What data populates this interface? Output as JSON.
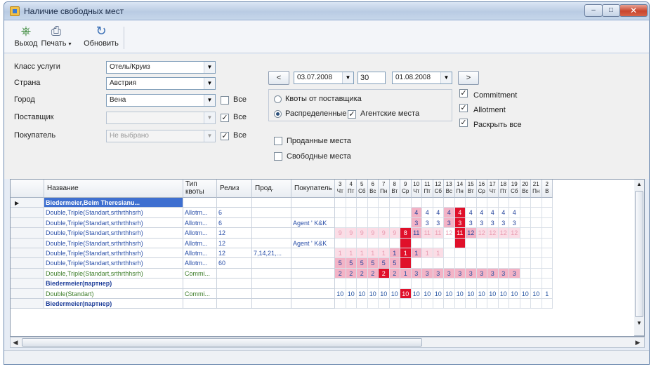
{
  "window": {
    "title": "Наличие свободных мест"
  },
  "toolbar": {
    "exit": "Выход",
    "print": "Печать",
    "refresh": "Обновить"
  },
  "filters": {
    "service_class": {
      "label": "Класс услуги",
      "value": "Отель/Круиз"
    },
    "country": {
      "label": "Страна",
      "value": "Австрия"
    },
    "city": {
      "label": "Город",
      "value": "Вена",
      "all_label": "Все"
    },
    "supplier": {
      "label": "Поставщик",
      "value": "",
      "all_label": "Все"
    },
    "buyer": {
      "label": "Покупатель",
      "value": "Не выбрано",
      "all_label": "Все"
    }
  },
  "period": {
    "prev": "<",
    "start": "03.07.2008",
    "days": "30",
    "end": "01.08.2008",
    "next": ">"
  },
  "quota": {
    "supplier_quota": "Квоты от поставщика",
    "distributed": "Распределенные",
    "agency_seats": "Агентские места"
  },
  "options": {
    "commitment": "Commitment",
    "allotment": "Allotment",
    "expand_all": "Раскрыть все"
  },
  "show": {
    "sold": "Проданные места",
    "free": "Свободные места"
  },
  "grid": {
    "headers": {
      "name": "Название",
      "type": "Тип квоты",
      "release": "Релиз",
      "prod": "Прод.",
      "buyer": "Покупатель"
    },
    "days": [
      {
        "d": "3",
        "w": "Чт"
      },
      {
        "d": "4",
        "w": "Пт"
      },
      {
        "d": "5",
        "w": "Сб"
      },
      {
        "d": "6",
        "w": "Вс"
      },
      {
        "d": "7",
        "w": "Пн"
      },
      {
        "d": "8",
        "w": "Вт"
      },
      {
        "d": "9",
        "w": "Ср"
      },
      {
        "d": "10",
        "w": "Чт"
      },
      {
        "d": "11",
        "w": "Пт"
      },
      {
        "d": "12",
        "w": "Сб"
      },
      {
        "d": "13",
        "w": "Вс"
      },
      {
        "d": "14",
        "w": "Пн"
      },
      {
        "d": "15",
        "w": "Вт"
      },
      {
        "d": "16",
        "w": "Ср"
      },
      {
        "d": "17",
        "w": "Чт"
      },
      {
        "d": "18",
        "w": "Пт"
      },
      {
        "d": "19",
        "w": "Сб"
      },
      {
        "d": "20",
        "w": "Вс"
      },
      {
        "d": "21",
        "w": "Пн"
      },
      {
        "d": "2",
        "w": "В"
      }
    ],
    "rows": [
      {
        "kind": "group",
        "name": "Biedermeier,Beim Theresianu...",
        "type": "",
        "release": "",
        "prod": "",
        "buyer": "",
        "selected": true,
        "cells": []
      },
      {
        "kind": "blue",
        "name": "Double,Triple(Standart,srthrthhsrh)",
        "type": "Allotm...",
        "release": "6",
        "prod": "",
        "buyer": "",
        "cells": [
          {
            "v": "",
            "s": ""
          },
          {
            "v": "",
            "s": ""
          },
          {
            "v": "",
            "s": ""
          },
          {
            "v": "",
            "s": ""
          },
          {
            "v": "",
            "s": ""
          },
          {
            "v": "",
            "s": ""
          },
          {
            "v": "",
            "s": ""
          },
          {
            "v": "4",
            "s": "p"
          },
          {
            "v": "4",
            "s": ""
          },
          {
            "v": "4",
            "s": ""
          },
          {
            "v": "4",
            "s": "p"
          },
          {
            "v": "4",
            "s": "r"
          },
          {
            "v": "4",
            "s": ""
          },
          {
            "v": "4",
            "s": ""
          },
          {
            "v": "4",
            "s": ""
          },
          {
            "v": "4",
            "s": ""
          },
          {
            "v": "4",
            "s": ""
          },
          {
            "v": "",
            "s": ""
          },
          {
            "v": "",
            "s": ""
          },
          {
            "v": "",
            "s": ""
          }
        ]
      },
      {
        "kind": "blue",
        "name": "Double,Triple(Standart,srthrthhsrh)",
        "type": "Allotm...",
        "release": "6",
        "prod": "",
        "buyer": "Agent ' K&K",
        "cells": [
          {
            "v": "",
            "s": ""
          },
          {
            "v": "",
            "s": ""
          },
          {
            "v": "",
            "s": ""
          },
          {
            "v": "",
            "s": ""
          },
          {
            "v": "",
            "s": ""
          },
          {
            "v": "",
            "s": ""
          },
          {
            "v": "",
            "s": ""
          },
          {
            "v": "3",
            "s": "p"
          },
          {
            "v": "3",
            "s": ""
          },
          {
            "v": "3",
            "s": ""
          },
          {
            "v": "3",
            "s": "p"
          },
          {
            "v": "3",
            "s": "r"
          },
          {
            "v": "3",
            "s": ""
          },
          {
            "v": "3",
            "s": ""
          },
          {
            "v": "3",
            "s": ""
          },
          {
            "v": "3",
            "s": ""
          },
          {
            "v": "3",
            "s": ""
          },
          {
            "v": "",
            "s": ""
          },
          {
            "v": "",
            "s": ""
          },
          {
            "v": "",
            "s": ""
          }
        ]
      },
      {
        "kind": "blue",
        "name": "Double,Triple(Standart,srthrthhsrh)",
        "type": "Allotm...",
        "release": "12",
        "prod": "",
        "buyer": "",
        "cells": [
          {
            "v": "9",
            "s": "l"
          },
          {
            "v": "9",
            "s": "l"
          },
          {
            "v": "9",
            "s": "l"
          },
          {
            "v": "9",
            "s": "l"
          },
          {
            "v": "9",
            "s": "l"
          },
          {
            "v": "9",
            "s": "l"
          },
          {
            "v": "8",
            "s": "r"
          },
          {
            "v": "11",
            "s": "p"
          },
          {
            "v": "11",
            "s": "l"
          },
          {
            "v": "11",
            "s": "l"
          },
          {
            "v": "12",
            "s": "f"
          },
          {
            "v": "11",
            "s": "r"
          },
          {
            "v": "12",
            "s": "p"
          },
          {
            "v": "12",
            "s": "l"
          },
          {
            "v": "12",
            "s": "l"
          },
          {
            "v": "12",
            "s": "l"
          },
          {
            "v": "12",
            "s": "l"
          },
          {
            "v": "",
            "s": ""
          },
          {
            "v": "",
            "s": ""
          },
          {
            "v": "",
            "s": ""
          }
        ]
      },
      {
        "kind": "blue",
        "name": "Double,Triple(Standart,srthrthhsrh)",
        "type": "Allotm...",
        "release": "12",
        "prod": "",
        "buyer": "Agent ' K&K",
        "cells": [
          {
            "v": "",
            "s": ""
          },
          {
            "v": "",
            "s": ""
          },
          {
            "v": "",
            "s": ""
          },
          {
            "v": "",
            "s": ""
          },
          {
            "v": "",
            "s": ""
          },
          {
            "v": "",
            "s": ""
          },
          {
            "v": "",
            "s": "r"
          },
          {
            "v": "",
            "s": ""
          },
          {
            "v": "",
            "s": ""
          },
          {
            "v": "",
            "s": ""
          },
          {
            "v": "",
            "s": ""
          },
          {
            "v": "",
            "s": "r"
          },
          {
            "v": "",
            "s": ""
          },
          {
            "v": "",
            "s": ""
          },
          {
            "v": "",
            "s": ""
          },
          {
            "v": "",
            "s": ""
          },
          {
            "v": "",
            "s": ""
          },
          {
            "v": "",
            "s": ""
          },
          {
            "v": "",
            "s": ""
          },
          {
            "v": "",
            "s": ""
          }
        ]
      },
      {
        "kind": "blue",
        "name": "Double,Triple(Standart,srthrthhsrh)",
        "type": "Allotm...",
        "release": "12",
        "prod": "7,14,21,...",
        "buyer": "",
        "cells": [
          {
            "v": "1",
            "s": "l"
          },
          {
            "v": "1",
            "s": "l"
          },
          {
            "v": "1",
            "s": "l"
          },
          {
            "v": "1",
            "s": "l"
          },
          {
            "v": "1",
            "s": "l"
          },
          {
            "v": "1",
            "s": "p"
          },
          {
            "v": "1",
            "s": "r"
          },
          {
            "v": "1",
            "s": "p"
          },
          {
            "v": "1",
            "s": "l"
          },
          {
            "v": "1",
            "s": "l"
          },
          {
            "v": "",
            "s": ""
          },
          {
            "v": "",
            "s": ""
          },
          {
            "v": "",
            "s": ""
          },
          {
            "v": "",
            "s": ""
          },
          {
            "v": "",
            "s": ""
          },
          {
            "v": "",
            "s": ""
          },
          {
            "v": "",
            "s": ""
          },
          {
            "v": "",
            "s": ""
          },
          {
            "v": "",
            "s": ""
          },
          {
            "v": "",
            "s": ""
          }
        ]
      },
      {
        "kind": "blue",
        "name": "Double,Triple(Standart,srthrthhsrh)",
        "type": "Allotm...",
        "release": "60",
        "prod": "",
        "buyer": "",
        "cells": [
          {
            "v": "5",
            "s": "p"
          },
          {
            "v": "5",
            "s": "p"
          },
          {
            "v": "5",
            "s": "p"
          },
          {
            "v": "5",
            "s": "p"
          },
          {
            "v": "5",
            "s": "p"
          },
          {
            "v": "5",
            "s": "p"
          },
          {
            "v": "",
            "s": "r"
          },
          {
            "v": "",
            "s": ""
          },
          {
            "v": "",
            "s": ""
          },
          {
            "v": "",
            "s": ""
          },
          {
            "v": "",
            "s": ""
          },
          {
            "v": "",
            "s": ""
          },
          {
            "v": "",
            "s": ""
          },
          {
            "v": "",
            "s": ""
          },
          {
            "v": "",
            "s": ""
          },
          {
            "v": "",
            "s": ""
          },
          {
            "v": "",
            "s": ""
          },
          {
            "v": "",
            "s": ""
          },
          {
            "v": "",
            "s": ""
          },
          {
            "v": "",
            "s": ""
          }
        ]
      },
      {
        "kind": "green",
        "name": "Double,Triple(Standart,srthrthhsrh)",
        "type": "Commi...",
        "release": "",
        "prod": "",
        "buyer": "",
        "cells": [
          {
            "v": "2",
            "s": "p"
          },
          {
            "v": "2",
            "s": "p"
          },
          {
            "v": "2",
            "s": "p"
          },
          {
            "v": "2",
            "s": "p"
          },
          {
            "v": "2",
            "s": "r"
          },
          {
            "v": "2",
            "s": "p"
          },
          {
            "v": "1",
            "s": "p"
          },
          {
            "v": "3",
            "s": "p"
          },
          {
            "v": "3",
            "s": "p"
          },
          {
            "v": "3",
            "s": "p"
          },
          {
            "v": "3",
            "s": "p"
          },
          {
            "v": "3",
            "s": "p"
          },
          {
            "v": "3",
            "s": "p"
          },
          {
            "v": "3",
            "s": "p"
          },
          {
            "v": "3",
            "s": "p"
          },
          {
            "v": "3",
            "s": "p"
          },
          {
            "v": "3",
            "s": "p"
          },
          {
            "v": "",
            "s": ""
          },
          {
            "v": "",
            "s": ""
          },
          {
            "v": "",
            "s": ""
          }
        ]
      },
      {
        "kind": "head",
        "name": "Biedermeier(партнер)",
        "type": "",
        "release": "",
        "prod": "",
        "buyer": "",
        "cells": []
      },
      {
        "kind": "green",
        "name": "Double(Standart)",
        "type": "Commi...",
        "release": "",
        "prod": "",
        "buyer": "",
        "cells": [
          {
            "v": "10",
            "s": ""
          },
          {
            "v": "10",
            "s": ""
          },
          {
            "v": "10",
            "s": ""
          },
          {
            "v": "10",
            "s": ""
          },
          {
            "v": "10",
            "s": ""
          },
          {
            "v": "10",
            "s": ""
          },
          {
            "v": "10",
            "s": "r"
          },
          {
            "v": "10",
            "s": ""
          },
          {
            "v": "10",
            "s": ""
          },
          {
            "v": "10",
            "s": ""
          },
          {
            "v": "10",
            "s": ""
          },
          {
            "v": "10",
            "s": ""
          },
          {
            "v": "10",
            "s": ""
          },
          {
            "v": "10",
            "s": ""
          },
          {
            "v": "10",
            "s": ""
          },
          {
            "v": "10",
            "s": ""
          },
          {
            "v": "10",
            "s": ""
          },
          {
            "v": "10",
            "s": ""
          },
          {
            "v": "10",
            "s": ""
          },
          {
            "v": "1",
            "s": ""
          }
        ]
      },
      {
        "kind": "head",
        "name": "Biedermeier(партнер)",
        "type": "",
        "release": "",
        "prod": "",
        "buyer": "",
        "cells": []
      }
    ]
  },
  "colors": {
    "red": "#e0102a",
    "pink": "#f3b3c6",
    "light": "#fbdde6",
    "blue_text": "#2a4fa8",
    "green_text": "#3d7d2a"
  }
}
